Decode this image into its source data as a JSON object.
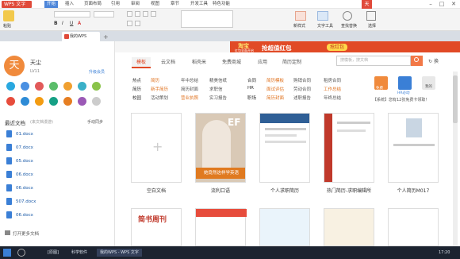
{
  "titlebar": {
    "app_title": "WPS 文字",
    "menus": [
      "开始",
      "插入",
      "页面布局",
      "引用",
      "审阅",
      "视图",
      "章节",
      "开发工具",
      "特色功能"
    ],
    "active_menu": "开始",
    "user_badge": "天"
  },
  "ribbon": {
    "paste_label": "粘贴",
    "font_name": "",
    "font_size": "",
    "font_labels": [
      "B",
      "I",
      "U",
      "A"
    ],
    "style_labels": [
      "新样式",
      "文字工具",
      "查找替换",
      "选择"
    ]
  },
  "tabs": {
    "doc_tab": "我的WPS"
  },
  "banner": {
    "ad_brand": "淘宝",
    "ad_sub": "红包全面开启",
    "ad_main": "抢超值红包",
    "ad_button": "抢红包"
  },
  "user": {
    "name": "天尘",
    "level": "LV11",
    "member_link": "升级会员",
    "avatar_char": "天"
  },
  "recent": {
    "header": "最近文档",
    "sub": "(来文档漫游)",
    "sync_label": "手动同步",
    "files": [
      "01.docx",
      "07.docx",
      "05.docx",
      "06.docx",
      "06.docx",
      "507.docx",
      "06.docx"
    ],
    "open_more": "打开更多文档"
  },
  "main": {
    "nav_tabs": [
      "模板",
      "云文档",
      "稻壳米",
      "免费商城",
      "应用",
      "简历定制"
    ],
    "active_tab": "模板",
    "search_placeholder": "搜模板，搜文档",
    "refresh_label": "换",
    "categories": [
      {
        "label": "热点",
        "items": [
          "简历",
          "年中总结",
          "精美信纸"
        ]
      },
      {
        "label": "简历",
        "items": [
          "新手简历",
          "简历封面",
          "求职信"
        ]
      },
      {
        "label": "校园",
        "items": [
          "活动策划",
          "营业执照",
          "实习报告"
        ]
      }
    ],
    "categories2": [
      {
        "label": "合同",
        "items": [
          "简历模板",
          "购销合同",
          "租房合同"
        ]
      },
      {
        "label": "HR",
        "items": [
          "面试评估",
          "劳动合同",
          "工作总结"
        ]
      },
      {
        "label": "职场",
        "items": [
          "简历封面",
          "述职报告",
          "年终总结"
        ]
      }
    ],
    "right_icons": [
      "免费",
      "HR必动",
      "我的"
    ],
    "notice": "【系统】您有12张免费卡领取！",
    "cards": [
      "空白文档",
      "流利口语",
      "个人求职简历",
      "热门简历-求职编辑所",
      "个人简历M017"
    ],
    "promo_text": "她竟然这样学英语",
    "promo_badge": "EF",
    "bottom_cards": [
      "简书周刊",
      "",
      "",
      "",
      ""
    ],
    "bottom_card_title": "简书周刊"
  },
  "taskbar": {
    "items": [
      "[原图]",
      "科学软件",
      "我的WPS - WPS 文字"
    ],
    "clock": "17:20"
  },
  "chart_data": null
}
